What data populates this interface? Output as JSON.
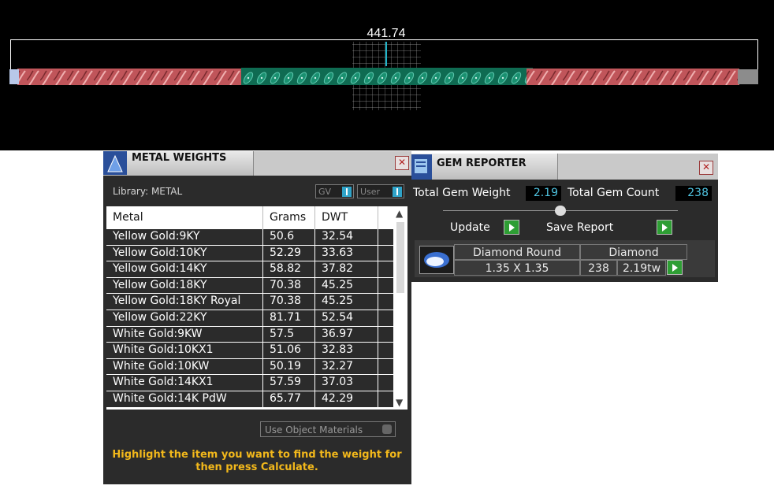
{
  "viewport": {
    "dimension": "441.74"
  },
  "metal_weights": {
    "title": "METAL WEIGHTS",
    "library_label": "Library: METAL",
    "toggle_gv": "GV",
    "toggle_user": "User",
    "columns": [
      "Metal",
      "Grams",
      "DWT"
    ],
    "rows": [
      [
        "Yellow Gold:9KY",
        "50.6",
        "32.54"
      ],
      [
        "Yellow Gold:10KY",
        "52.29",
        "33.63"
      ],
      [
        "Yellow Gold:14KY",
        "58.82",
        "37.82"
      ],
      [
        "Yellow Gold:18KY",
        "70.38",
        "45.25"
      ],
      [
        "Yellow Gold:18KY Royal",
        "70.38",
        "45.25"
      ],
      [
        "Yellow Gold:22KY",
        "81.71",
        "52.54"
      ],
      [
        "White Gold:9KW",
        "57.5",
        "36.97"
      ],
      [
        "White Gold:10KX1",
        "51.06",
        "32.83"
      ],
      [
        "White Gold:10KW",
        "50.19",
        "32.27"
      ],
      [
        "White Gold:14KX1",
        "57.59",
        "37.03"
      ],
      [
        "White Gold:14K PdW",
        "65.77",
        "42.29"
      ]
    ],
    "use_object_materials": "Use Object Materials",
    "hint": "Highlight the item you want to find the weight for then press Calculate."
  },
  "gem_reporter": {
    "title": "GEM REPORTER",
    "total_weight_label": "Total Gem Weight",
    "total_weight_value": "2.19",
    "total_count_label": "Total Gem Count",
    "total_count_value": "238",
    "update_label": "Update",
    "save_report_label": "Save Report",
    "gem": {
      "shape": "Diamond Round",
      "size": "1.35 X 1.35",
      "material": "Diamond",
      "count": "238",
      "weight": "2.19tw"
    }
  },
  "colors": {
    "accent_blue": "#4fc3e0",
    "go_green": "#2e9e34",
    "hint_yellow": "#f2b81b"
  }
}
